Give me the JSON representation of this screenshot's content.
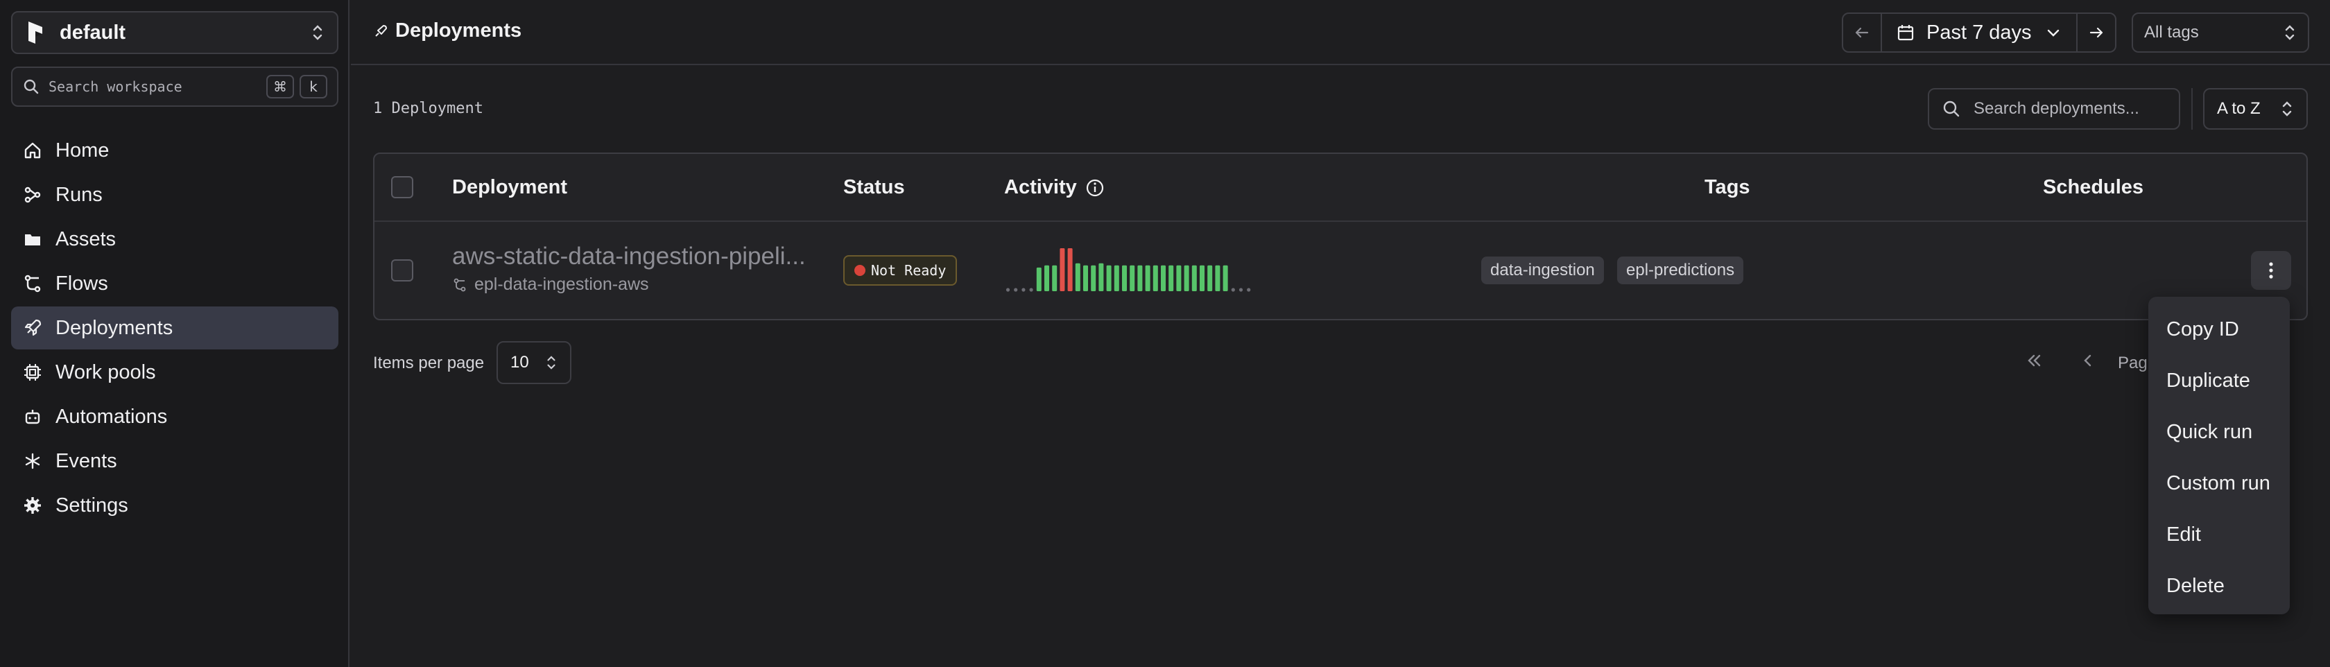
{
  "workspace": {
    "name": "default"
  },
  "search": {
    "placeholder": "Search workspace",
    "shortcut_modifier": "⌘",
    "shortcut_key": "k"
  },
  "sidebar": {
    "items": [
      {
        "label": "Home",
        "icon": "home-icon"
      },
      {
        "label": "Runs",
        "icon": "runs-icon"
      },
      {
        "label": "Assets",
        "icon": "folder-icon"
      },
      {
        "label": "Flows",
        "icon": "flows-icon"
      },
      {
        "label": "Deployments",
        "icon": "rocket-icon",
        "active": true
      },
      {
        "label": "Work pools",
        "icon": "cpu-icon"
      },
      {
        "label": "Automations",
        "icon": "bot-icon"
      },
      {
        "label": "Events",
        "icon": "asterisk-icon"
      },
      {
        "label": "Settings",
        "icon": "gear-icon"
      }
    ]
  },
  "header": {
    "title": "Deployments",
    "date_range": "Past 7 days",
    "tags_select": "All tags"
  },
  "toolbar": {
    "count": "1 Deployment",
    "search_placeholder": "Search deployments...",
    "sort": "A to Z"
  },
  "table": {
    "columns": [
      "Deployment",
      "Status",
      "Activity",
      "Tags",
      "Schedules"
    ],
    "rows": [
      {
        "name": "aws-static-data-ingestion-pipeli...",
        "flow": "epl-data-ingestion-aws",
        "status": "Not Ready",
        "activity": [
          "none",
          "none",
          "none",
          "none",
          "completed",
          "completed",
          "completed",
          "failed",
          "failed",
          "completed",
          "completed",
          "completed",
          "completed",
          "completed",
          "completed",
          "completed",
          "completed",
          "completed",
          "completed",
          "completed",
          "completed",
          "completed",
          "completed",
          "completed",
          "completed",
          "completed",
          "completed",
          "completed",
          "completed",
          "none",
          "none",
          "none"
        ],
        "activity_levels": [
          0,
          0,
          0,
          0,
          0.55,
          0.6,
          0.6,
          1,
          1,
          0.65,
          0.6,
          0.6,
          0.65,
          0.6,
          0.6,
          0.6,
          0.6,
          0.6,
          0.6,
          0.6,
          0.6,
          0.6,
          0.6,
          0.6,
          0.6,
          0.6,
          0.6,
          0.6,
          0.6,
          0,
          0,
          0
        ],
        "tags": [
          "data-ingestion",
          "epl-predictions"
        ]
      }
    ]
  },
  "pagination": {
    "items_per_page_label": "Items per page",
    "items_per_page": "10",
    "page_text": "Pag"
  },
  "menu": {
    "items": [
      "Copy ID",
      "Duplicate",
      "Quick run",
      "Custom run",
      "Edit",
      "Delete"
    ]
  },
  "colors": {
    "completed": "#57c46a",
    "failed": "#e0514a",
    "none": "#6d6d74",
    "active_nav": "#383a47"
  }
}
